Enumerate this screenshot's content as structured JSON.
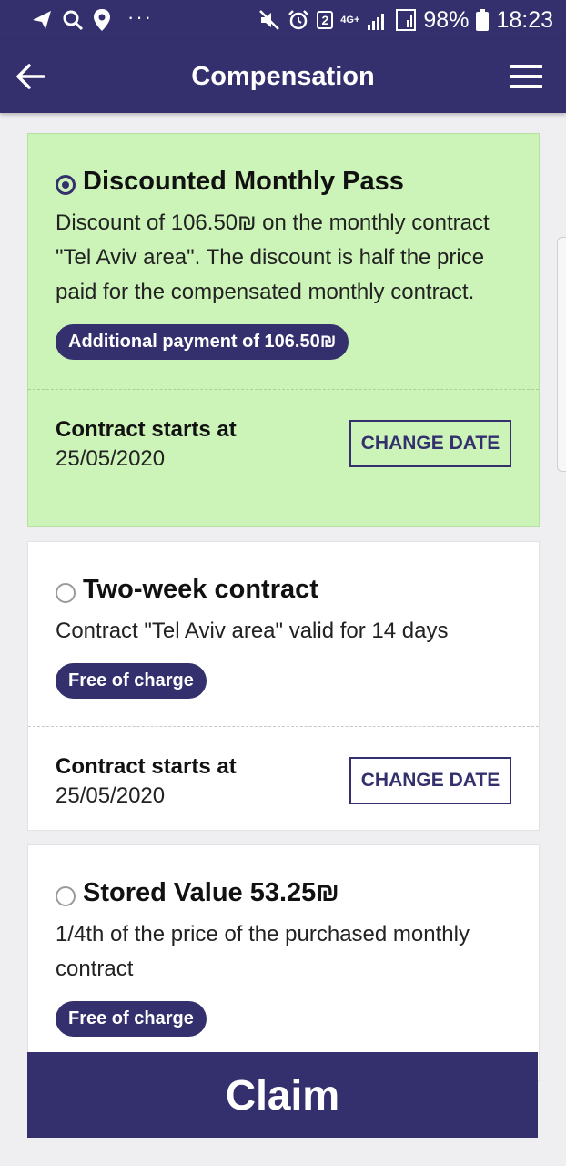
{
  "status_bar": {
    "battery": "98%",
    "time": "18:23",
    "sim_badge": "2",
    "network": "4G+",
    "more": "···"
  },
  "app_bar": {
    "title": "Compensation"
  },
  "options": [
    {
      "title": "Discounted Monthly Pass",
      "selected": true,
      "description": "Discount of 106.50₪ on the monthly contract \"Tel Aviv area\". The discount is half the price paid for the compensated monthly contract.",
      "badge": "Additional payment of 106.50₪",
      "starts_label": "Contract starts at",
      "starts_date": "25/05/2020",
      "change_label": "CHANGE DATE"
    },
    {
      "title": "Two-week contract",
      "selected": false,
      "description": "Contract \"Tel Aviv area\" valid for 14 days",
      "badge": "Free of charge",
      "starts_label": "Contract starts at",
      "starts_date": "25/05/2020",
      "change_label": "CHANGE DATE"
    },
    {
      "title": "Stored Value 53.25₪",
      "selected": false,
      "description": "1/4th of the price of the purchased monthly contract",
      "badge": "Free of charge"
    }
  ],
  "claim_label": "Claim",
  "colors": {
    "brand": "#34306e",
    "selected_card": "#cdf4b8",
    "background": "#efeff1"
  }
}
